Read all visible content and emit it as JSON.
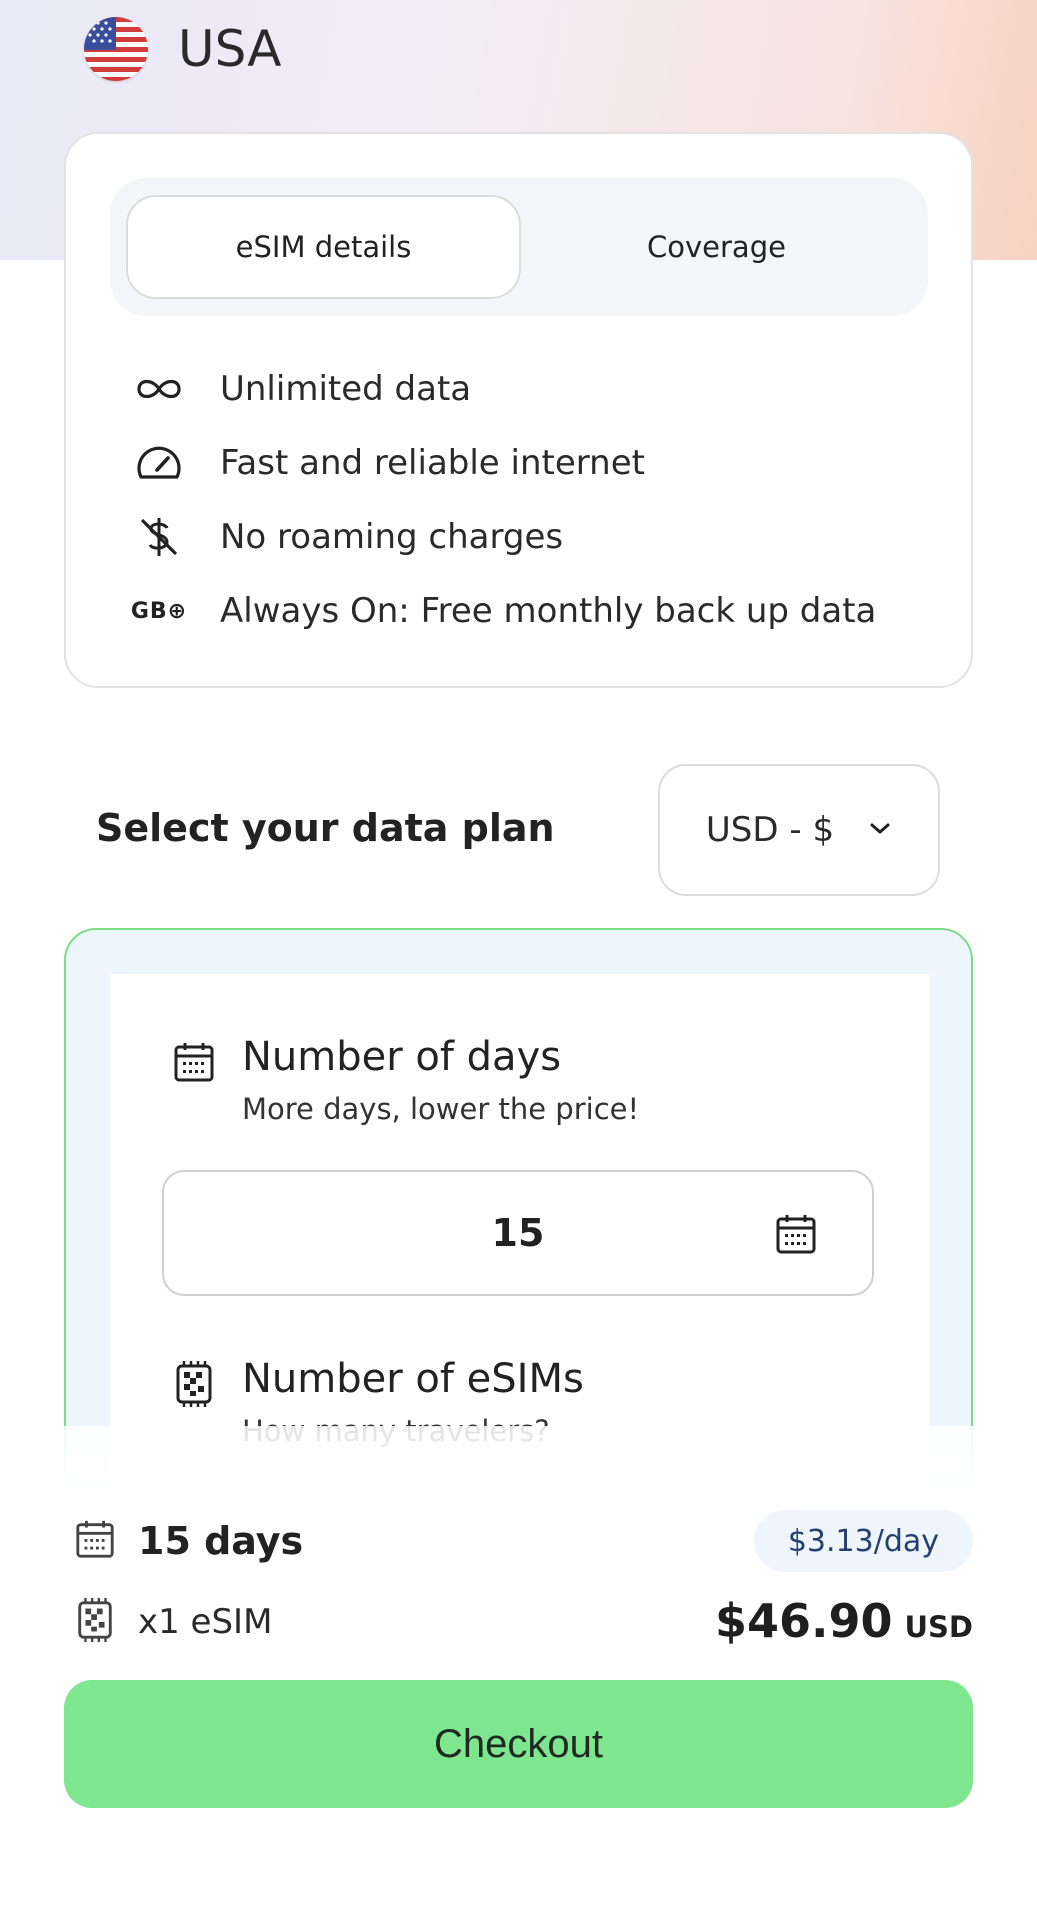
{
  "header": {
    "country": "USA",
    "flag_icon": "us-flag-icon"
  },
  "tabs": [
    {
      "label": "eSIM details",
      "active": true
    },
    {
      "label": "Coverage",
      "active": false
    }
  ],
  "features": [
    {
      "icon": "infinity-icon",
      "text": "Unlimited data"
    },
    {
      "icon": "speedometer-icon",
      "text": "Fast and reliable internet"
    },
    {
      "icon": "no-dollar-icon",
      "text": "No roaming charges"
    },
    {
      "icon": "gb-plus-icon",
      "icon_text": "GB⊕",
      "text": "Always On: Free monthly back up data"
    }
  ],
  "plan": {
    "title": "Select your data plan",
    "currency_selected": "USD - $",
    "days_section": {
      "title": "Number of days",
      "subtitle": "More days, lower the price!",
      "value": "15"
    },
    "esims_section": {
      "title": "Number of eSIMs",
      "subtitle": "How many travelers?"
    }
  },
  "summary": {
    "days": "15 days",
    "per_day": "$3.13/day",
    "esims": "x1 eSIM",
    "total_price": "$46.90",
    "total_currency": "USD",
    "checkout_label": "Checkout"
  },
  "colors": {
    "accent_green": "#7de68f",
    "plan_border": "#7ddb86",
    "per_day_bg": "#eef5fc",
    "per_day_text": "#24406f"
  }
}
